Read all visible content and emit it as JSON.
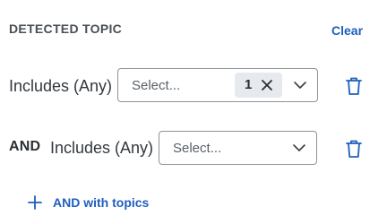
{
  "header": {
    "title": "DETECTED TOPIC",
    "clear_label": "Clear"
  },
  "rows": [
    {
      "label": "Includes (Any)",
      "select_placeholder": "Select...",
      "selected_count": "1"
    },
    {
      "prefix": "AND",
      "label": "Includes (Any)",
      "select_placeholder": "Select..."
    }
  ],
  "footer": {
    "add_label": "AND with topics"
  },
  "colors": {
    "accent": "#1f5fbf",
    "text": "#33383d",
    "border": "#8e949a",
    "chip_bg": "#e6eaef"
  },
  "icons": {
    "remove": "close-icon",
    "dropdown": "chevron-down-icon",
    "delete": "trash-icon",
    "add": "plus-icon"
  }
}
